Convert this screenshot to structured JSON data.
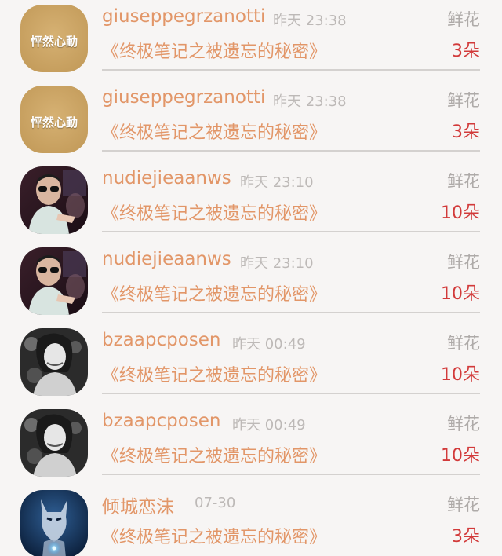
{
  "colors": {
    "username": "#e29668",
    "book_title": "#e29668",
    "time": "#bdb9b7",
    "gift_type": "#aeaaa8",
    "count": "#d23a3a",
    "divider": "#d4d1cf"
  },
  "records": [
    {
      "avatar": "calligraphy-avatar",
      "avatar_text": "怦然心動",
      "username": "giuseppegrzanotti",
      "time": "昨天 23:38",
      "gift_type": "鲜花",
      "book_title": "《终极笔记之被遗忘的秘密》",
      "count": "3朵"
    },
    {
      "avatar": "calligraphy-avatar",
      "avatar_text": "怦然心動",
      "username": "giuseppegrzanotti",
      "time": "昨天 23:38",
      "gift_type": "鲜花",
      "book_title": "《终极笔记之被遗忘的秘密》",
      "count": "3朵"
    },
    {
      "avatar": "photo-avatar-man-sunglasses",
      "avatar_text": "",
      "username": "nudiejieaanws",
      "time": "昨天 23:10",
      "gift_type": "鲜花",
      "book_title": "《终极笔记之被遗忘的秘密》",
      "count": "10朵"
    },
    {
      "avatar": "photo-avatar-man-sunglasses",
      "avatar_text": "",
      "username": "nudiejieaanws",
      "time": "昨天 23:10",
      "gift_type": "鲜花",
      "book_title": "《终极笔记之被遗忘的秘密》",
      "count": "10朵"
    },
    {
      "avatar": "photo-avatar-woman-bw",
      "avatar_text": "",
      "username": "bzaapcposen",
      "time": "昨天 00:49",
      "gift_type": "鲜花",
      "book_title": "《终极笔记之被遗忘的秘密》",
      "count": "10朵"
    },
    {
      "avatar": "photo-avatar-woman-bw",
      "avatar_text": "",
      "username": "bzaapcposen",
      "time": "昨天 00:49",
      "gift_type": "鲜花",
      "book_title": "《终极笔记之被遗忘的秘密》",
      "count": "10朵"
    },
    {
      "avatar": "photo-avatar-wolf",
      "avatar_text": "",
      "username": "倾城恋沫",
      "time": "07-30",
      "gift_type": "鲜花",
      "book_title": "《终极笔记之被遗忘的秘密》",
      "count": "3朵"
    }
  ]
}
